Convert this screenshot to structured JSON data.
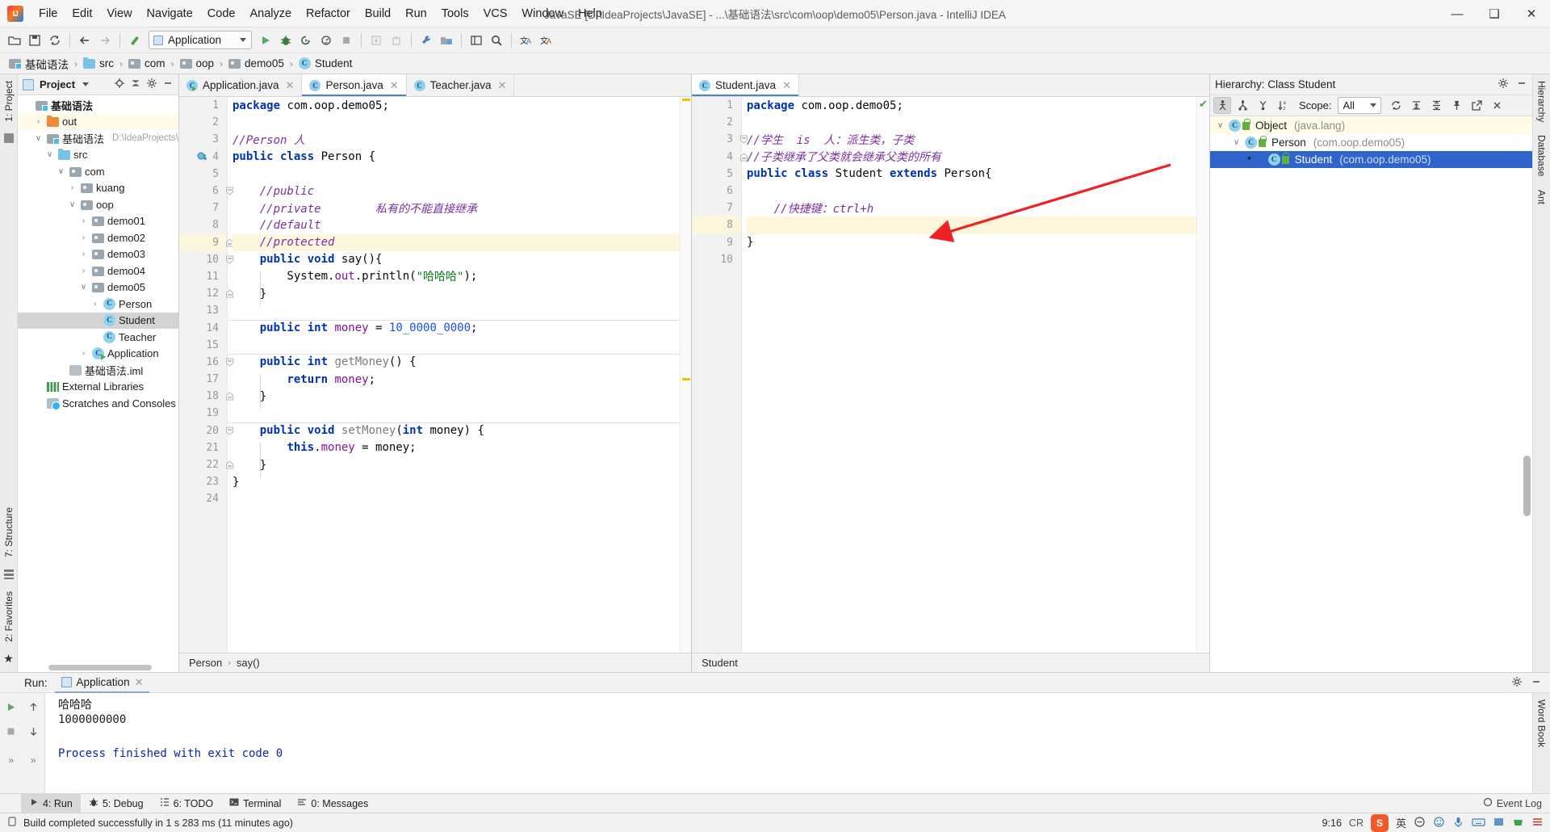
{
  "window": {
    "title": "JavaSE [D:\\IdeaProjects\\JavaSE] - ...\\基础语法\\src\\com\\oop\\demo05\\Person.java - IntelliJ IDEA",
    "minimize": "—",
    "maximize": "❑",
    "close": "✕"
  },
  "menubar": [
    {
      "label": "File"
    },
    {
      "label": "Edit"
    },
    {
      "label": "View"
    },
    {
      "label": "Navigate"
    },
    {
      "label": "Code"
    },
    {
      "label": "Analyze"
    },
    {
      "label": "Refactor"
    },
    {
      "label": "Build"
    },
    {
      "label": "Run"
    },
    {
      "label": "Tools"
    },
    {
      "label": "VCS"
    },
    {
      "label": "Window"
    },
    {
      "label": "Help"
    }
  ],
  "toolbar": {
    "run_config": "Application",
    "icons": [
      "open-folder-icon",
      "save-icon",
      "sync-icon",
      "back-icon",
      "forward-icon",
      "build-icon",
      "run-icon",
      "debug-icon",
      "run-coverage-icon",
      "profile-icon",
      "stop-icon",
      "update-project-icon",
      "commit-icon",
      "settings-wrench-icon",
      "project-structure-icon",
      "layout-icon",
      "search-everywhere-icon",
      "translate-icon",
      "translate-alt-icon"
    ]
  },
  "breadcrumb": [
    {
      "label": "基础语法",
      "icon": "module-icon"
    },
    {
      "label": "src",
      "icon": "source-folder-icon"
    },
    {
      "label": "com",
      "icon": "package-icon"
    },
    {
      "label": "oop",
      "icon": "package-icon"
    },
    {
      "label": "demo05",
      "icon": "package-icon"
    },
    {
      "label": "Student",
      "icon": "class-icon"
    }
  ],
  "left_strip": [
    {
      "label": "1: Project",
      "underline": "1"
    },
    {
      "label": "7: Structure",
      "underline": "7"
    },
    {
      "label": "2: Favorites",
      "underline": "2"
    }
  ],
  "right_strip": [
    {
      "label": "Hierarchy"
    },
    {
      "label": "Database"
    },
    {
      "label": "Ant"
    },
    {
      "label": "Word Book"
    }
  ],
  "project_panel": {
    "title": "Project",
    "tree": [
      {
        "label": "基础语法",
        "indent": 0,
        "icon": "module-icon",
        "arrow": "",
        "bold": true,
        "state": "normal",
        "dim": ""
      },
      {
        "label": "out",
        "indent": 1,
        "icon": "folder-orange-icon",
        "arrow": "›",
        "bold": false,
        "state": "highlight",
        "dim": ""
      },
      {
        "label": "基础语法",
        "indent": 1,
        "icon": "module-icon",
        "arrow": "∨",
        "bold": false,
        "state": "normal",
        "dim": "D:\\IdeaProjects\\Ja"
      },
      {
        "label": "src",
        "indent": 2,
        "icon": "folder-blue-icon",
        "arrow": "∨",
        "bold": false,
        "state": "normal",
        "dim": ""
      },
      {
        "label": "com",
        "indent": 3,
        "icon": "package-icon",
        "arrow": "∨",
        "bold": false,
        "state": "normal",
        "dim": ""
      },
      {
        "label": "kuang",
        "indent": 4,
        "icon": "package-icon",
        "arrow": "›",
        "bold": false,
        "state": "normal",
        "dim": ""
      },
      {
        "label": "oop",
        "indent": 4,
        "icon": "package-icon",
        "arrow": "∨",
        "bold": false,
        "state": "normal",
        "dim": ""
      },
      {
        "label": "demo01",
        "indent": 5,
        "icon": "package-icon",
        "arrow": "›",
        "bold": false,
        "state": "normal",
        "dim": ""
      },
      {
        "label": "demo02",
        "indent": 5,
        "icon": "package-icon",
        "arrow": "›",
        "bold": false,
        "state": "normal",
        "dim": ""
      },
      {
        "label": "demo03",
        "indent": 5,
        "icon": "package-icon",
        "arrow": "›",
        "bold": false,
        "state": "normal",
        "dim": ""
      },
      {
        "label": "demo04",
        "indent": 5,
        "icon": "package-icon",
        "arrow": "›",
        "bold": false,
        "state": "normal",
        "dim": ""
      },
      {
        "label": "demo05",
        "indent": 5,
        "icon": "package-icon",
        "arrow": "∨",
        "bold": false,
        "state": "normal",
        "dim": ""
      },
      {
        "label": "Person",
        "indent": 6,
        "icon": "class-icon",
        "arrow": "›",
        "bold": false,
        "state": "normal",
        "dim": ""
      },
      {
        "label": "Student",
        "indent": 6,
        "icon": "class-icon",
        "arrow": "",
        "bold": false,
        "state": "selected",
        "dim": ""
      },
      {
        "label": "Teacher",
        "indent": 6,
        "icon": "class-icon",
        "arrow": "",
        "bold": false,
        "state": "normal",
        "dim": ""
      },
      {
        "label": "Application",
        "indent": 5,
        "icon": "class-run-icon",
        "arrow": "›",
        "bold": false,
        "state": "normal",
        "dim": ""
      },
      {
        "label": "基础语法.iml",
        "indent": 3,
        "icon": "iml-icon",
        "arrow": "",
        "bold": false,
        "state": "normal",
        "dim": ""
      },
      {
        "label": "External Libraries",
        "indent": 1,
        "icon": "libraries-icon",
        "arrow": "",
        "bold": false,
        "state": "normal",
        "dim": ""
      },
      {
        "label": "Scratches and Consoles",
        "indent": 1,
        "icon": "scratches-icon",
        "arrow": "",
        "bold": false,
        "state": "normal",
        "dim": ""
      }
    ]
  },
  "editor_left": {
    "tabs": [
      {
        "label": "Application.java",
        "active": false,
        "icon": "class-run-icon",
        "close": "✕"
      },
      {
        "label": "Person.java",
        "active": true,
        "icon": "class-icon",
        "close": "✕"
      },
      {
        "label": "Teacher.java",
        "active": false,
        "icon": "class-icon",
        "close": "✕"
      }
    ],
    "line_numbers": [
      "1",
      "2",
      "3",
      "4",
      "5",
      "6",
      "7",
      "8",
      "9",
      "10",
      "11",
      "12",
      "13",
      "14",
      "15",
      "16",
      "17",
      "18",
      "19",
      "20",
      "21",
      "22",
      "23",
      "24"
    ],
    "highlight_line": 9,
    "lines": [
      {
        "n": 1,
        "tokens": [
          {
            "t": "package ",
            "c": "kw"
          },
          {
            "t": "com.oop.demo05;",
            "c": "pln"
          }
        ],
        "indent": 0
      },
      {
        "n": 2,
        "tokens": [],
        "indent": 0
      },
      {
        "n": 3,
        "tokens": [
          {
            "t": "//Person 人",
            "c": "cmt"
          }
        ],
        "indent": 0
      },
      {
        "n": 4,
        "tokens": [
          {
            "t": "public class ",
            "c": "kw"
          },
          {
            "t": "Person {",
            "c": "pln"
          }
        ],
        "indent": 0
      },
      {
        "n": 5,
        "tokens": [],
        "indent": 0
      },
      {
        "n": 6,
        "tokens": [
          {
            "t": "    //public",
            "c": "cmt"
          }
        ],
        "indent": 0
      },
      {
        "n": 7,
        "tokens": [
          {
            "t": "    //private        私有的不能直接继承",
            "c": "cmt"
          }
        ],
        "indent": 0
      },
      {
        "n": 8,
        "tokens": [
          {
            "t": "    //default",
            "c": "cmt"
          }
        ],
        "indent": 0
      },
      {
        "n": 9,
        "tokens": [
          {
            "t": "    //protected",
            "c": "cmt"
          }
        ],
        "indent": 0
      },
      {
        "n": 10,
        "tokens": [
          {
            "t": "    ",
            "c": "pln"
          },
          {
            "t": "public void ",
            "c": "kw"
          },
          {
            "t": "say(){",
            "c": "pln"
          }
        ],
        "indent": 0
      },
      {
        "n": 11,
        "tokens": [
          {
            "t": "        System.",
            "c": "pln"
          },
          {
            "t": "out",
            "c": "fld"
          },
          {
            "t": ".println(",
            "c": "pln"
          },
          {
            "t": "\"哈哈哈\"",
            "c": "str"
          },
          {
            "t": ");",
            "c": "pln"
          }
        ],
        "indent": 0
      },
      {
        "n": 12,
        "tokens": [
          {
            "t": "    }",
            "c": "pln"
          }
        ],
        "indent": 0
      },
      {
        "n": 13,
        "tokens": [],
        "indent": 0
      },
      {
        "n": 14,
        "tokens": [
          {
            "t": "    ",
            "c": "pln"
          },
          {
            "t": "public int ",
            "c": "kw"
          },
          {
            "t": "money",
            "c": "fld"
          },
          {
            "t": " = ",
            "c": "pln"
          },
          {
            "t": "10_0000_0000",
            "c": "num"
          },
          {
            "t": ";",
            "c": "pln"
          }
        ],
        "indent": 0
      },
      {
        "n": 15,
        "tokens": [],
        "indent": 0
      },
      {
        "n": 16,
        "tokens": [
          {
            "t": "    ",
            "c": "pln"
          },
          {
            "t": "public int ",
            "c": "kw"
          },
          {
            "t": "getMoney",
            "c": "mth"
          },
          {
            "t": "() {",
            "c": "pln"
          }
        ],
        "indent": 0
      },
      {
        "n": 17,
        "tokens": [
          {
            "t": "        ",
            "c": "pln"
          },
          {
            "t": "return ",
            "c": "kw"
          },
          {
            "t": "money",
            "c": "fld"
          },
          {
            "t": ";",
            "c": "pln"
          }
        ],
        "indent": 0
      },
      {
        "n": 18,
        "tokens": [
          {
            "t": "    }",
            "c": "pln"
          }
        ],
        "indent": 0
      },
      {
        "n": 19,
        "tokens": [],
        "indent": 0
      },
      {
        "n": 20,
        "tokens": [
          {
            "t": "    ",
            "c": "pln"
          },
          {
            "t": "public void ",
            "c": "kw"
          },
          {
            "t": "setMoney",
            "c": "mth"
          },
          {
            "t": "(",
            "c": "pln"
          },
          {
            "t": "int ",
            "c": "kw"
          },
          {
            "t": "money) {",
            "c": "pln"
          }
        ],
        "indent": 0
      },
      {
        "n": 21,
        "tokens": [
          {
            "t": "        ",
            "c": "pln"
          },
          {
            "t": "this",
            "c": "kw"
          },
          {
            "t": ".",
            "c": "pln"
          },
          {
            "t": "money",
            "c": "fld"
          },
          {
            "t": " = money;",
            "c": "pln"
          }
        ],
        "indent": 0
      },
      {
        "n": 22,
        "tokens": [
          {
            "t": "    }",
            "c": "pln"
          }
        ],
        "indent": 0
      },
      {
        "n": 23,
        "tokens": [
          {
            "t": "}",
            "c": "pln"
          }
        ],
        "indent": 0
      },
      {
        "n": 24,
        "tokens": [],
        "indent": 0
      }
    ],
    "footer": {
      "class": "Person",
      "sep": "›",
      "method": "say()"
    }
  },
  "editor_right": {
    "tabs": [
      {
        "label": "Student.java",
        "active": true,
        "icon": "class-icon",
        "close": "✕"
      }
    ],
    "line_numbers": [
      "1",
      "2",
      "3",
      "4",
      "5",
      "6",
      "7",
      "8",
      "9",
      "10"
    ],
    "highlight_line": 8,
    "lines": [
      {
        "n": 1,
        "tokens": [
          {
            "t": "package ",
            "c": "kw"
          },
          {
            "t": "com.oop.demo05;",
            "c": "pln"
          }
        ]
      },
      {
        "n": 2,
        "tokens": []
      },
      {
        "n": 3,
        "tokens": [
          {
            "t": "//学生  is  人：派生类，子类",
            "c": "cmt"
          }
        ]
      },
      {
        "n": 4,
        "tokens": [
          {
            "t": "//子类继承了父类就会继承父类的所有",
            "c": "cmt"
          }
        ]
      },
      {
        "n": 5,
        "tokens": [
          {
            "t": "public class ",
            "c": "kw"
          },
          {
            "t": "Student ",
            "c": "pln"
          },
          {
            "t": "extends ",
            "c": "kw"
          },
          {
            "t": "Person{",
            "c": "pln"
          }
        ]
      },
      {
        "n": 6,
        "tokens": []
      },
      {
        "n": 7,
        "tokens": [
          {
            "t": "    //快捷键：ctrl+h",
            "c": "cmt"
          }
        ]
      },
      {
        "n": 8,
        "tokens": []
      },
      {
        "n": 9,
        "tokens": [
          {
            "t": "}",
            "c": "pln"
          }
        ]
      },
      {
        "n": 10,
        "tokens": []
      }
    ],
    "footer": {
      "class": "Student"
    },
    "inspection_status": "ok-check-icon"
  },
  "hierarchy": {
    "title": "Hierarchy:  Class Student",
    "tool_icons": [
      "type-hierarchy-icon",
      "supertypes-hierarchy-icon",
      "subtypes-hierarchy-icon",
      "sort-alphabetically-icon"
    ],
    "scope_label": "Scope:",
    "scope_value": "All",
    "right_icons": [
      "refresh-icon",
      "expand-all-icon",
      "collapse-all-icon",
      "pin-icon",
      "open-in-new-window-icon",
      "close-icon"
    ],
    "settings_icon": "gear-icon",
    "minimize_icon": "minimize-icon",
    "tree": [
      {
        "label": "Object",
        "pkg": "(java.lang)",
        "indent": 0,
        "arrow": "∨",
        "state": "highlight",
        "star": false
      },
      {
        "label": "Person",
        "pkg": "(com.oop.demo05)",
        "indent": 1,
        "arrow": "∨",
        "state": "normal",
        "star": false
      },
      {
        "label": "Student",
        "pkg": "(com.oop.demo05)",
        "indent": 2,
        "arrow": "",
        "state": "selected",
        "star": true
      }
    ]
  },
  "run_panel": {
    "label": "Run:",
    "tab": "Application",
    "tab_close": "✕",
    "output": [
      {
        "text": "哈哈哈",
        "style": "plain"
      },
      {
        "text": "1000000000",
        "style": "plain"
      },
      {
        "text": "",
        "style": "plain"
      },
      {
        "text": "Process finished with exit code 0",
        "style": "blue"
      }
    ],
    "side_icons": [
      "rerun-icon",
      "stop-icon",
      "up-arrow-icon",
      "down-arrow-icon",
      "expand-more-icon",
      "expand-more-alt-icon"
    ],
    "header_icons": [
      "gear-icon",
      "minimize-icon"
    ]
  },
  "bottom_tabs": [
    {
      "label": "4: Run",
      "underline": "4",
      "icon": "run-icon",
      "active": true
    },
    {
      "label": "5: Debug",
      "underline": "5",
      "icon": "debug-icon",
      "active": false
    },
    {
      "label": "6: TODO",
      "underline": "6",
      "icon": "todo-icon",
      "active": false
    },
    {
      "label": "Terminal",
      "underline": "",
      "icon": "terminal-icon",
      "active": false
    },
    {
      "label": "0: Messages",
      "underline": "0",
      "icon": "messages-icon",
      "active": false
    }
  ],
  "bottom_right": {
    "label": "Event Log",
    "icon": "event-log-icon"
  },
  "statusbar": {
    "message": "Build completed successfully in 1 s 283 ms (11 minutes ago)",
    "icon": "build-status-icon",
    "time": "9:16",
    "tray": [
      "sogou-icon",
      "英",
      "sogou-tool-1",
      "smiley-icon",
      "mic-icon",
      "keyboard-icon",
      "panel-icon",
      "basket-icon",
      "menu-icon"
    ]
  },
  "colors": {
    "accent": "#2f65ca",
    "keyword": "#0033b3",
    "comment": "#7a2fa0",
    "string": "#067d17",
    "number": "#1750eb",
    "field": "#871094",
    "highlight_row": "#fffbe6",
    "arrow_annotation": "#ee2222"
  }
}
